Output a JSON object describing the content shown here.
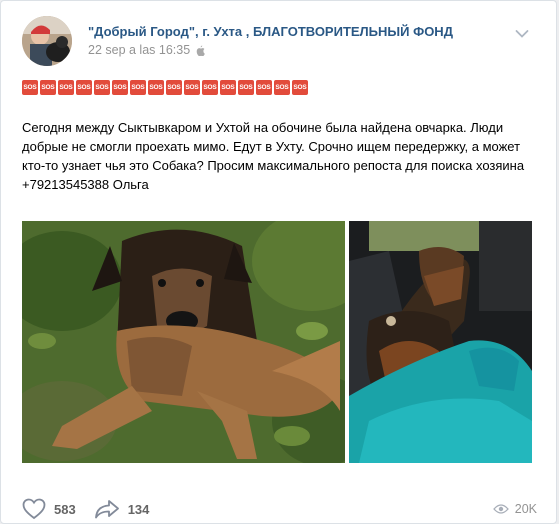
{
  "post": {
    "author": "\"Добрый Город\", г. Ухта , БЛАГОТВОРИТЕЛЬНЫЙ ФОНД",
    "date": "22 sep a las 16:35",
    "sos_badges": [
      "SOS",
      "SOS",
      "SOS",
      "SOS",
      "SOS",
      "SOS",
      "SOS",
      "SOS",
      "SOS",
      "SOS",
      "SOS",
      "SOS",
      "SOS",
      "SOS",
      "SOS",
      "SOS"
    ],
    "text_line1": "Сегодня между Сыктывкаром и Ухтой на обочине была найдена овчарка. Люди добрые не смогли проехать мимо. Едут в Ухту. Срочно ищем передержку, а может кто-то узнает чья это Собака? Просим максимального репоста для поиска хозяина",
    "text_line2": "+79213545388 Ольга"
  },
  "actions": {
    "likes": "583",
    "shares": "134",
    "views": "20K"
  },
  "colors": {
    "link": "#2a5885",
    "sos": "#e24b3b",
    "muted": "#939393",
    "action_text": "#656565"
  },
  "icons": [
    "avatar-image",
    "apple-icon",
    "chevron-down-icon",
    "heart-icon",
    "share-icon",
    "eye-icon"
  ]
}
